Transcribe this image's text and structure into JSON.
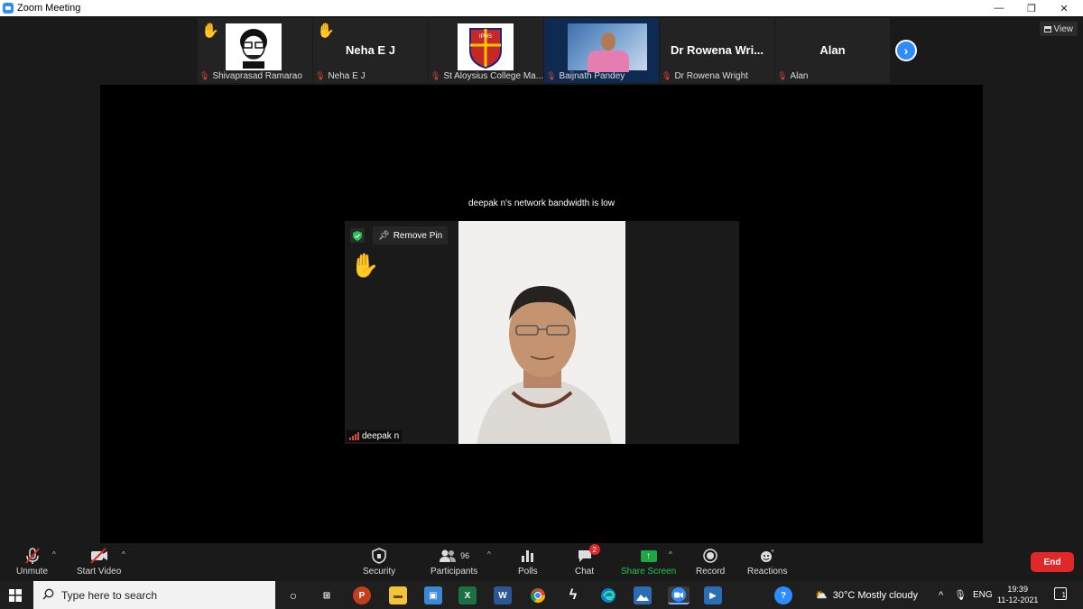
{
  "window": {
    "title": "Zoom Meeting",
    "minimize": "—",
    "restore": "❐",
    "close": "✕"
  },
  "view_button": {
    "label": "View"
  },
  "participants_strip": [
    {
      "name": "Shivaprasad Ramarao",
      "hand_raised": true,
      "muted": true,
      "avatar": "cartoon-avatar"
    },
    {
      "name": "Neha E J",
      "display": "Neha E J",
      "hand_raised": true,
      "muted": true
    },
    {
      "name": "St Aloysius College Ma...",
      "hand_raised": false,
      "muted": true,
      "avatar": "college-crest",
      "crest_text": "IPHS"
    },
    {
      "name": "Baijnath Pandey",
      "hand_raised": false,
      "muted": true,
      "avatar": "video-feed"
    },
    {
      "name": "Dr Rowena Wright",
      "display": "Dr Rowena Wri...",
      "hand_raised": false,
      "muted": true
    },
    {
      "name": "Alan",
      "display": "Alan",
      "hand_raised": false,
      "muted": true
    }
  ],
  "main_view": {
    "notice": "deepak n's network bandwidth is low",
    "pinned_name": "deepak n",
    "remove_pin_label": "Remove Pin"
  },
  "toolbar": {
    "unmute": "Unmute",
    "start_video": "Start Video",
    "security": "Security",
    "participants": "Participants",
    "participants_count": "96",
    "polls": "Polls",
    "chat": "Chat",
    "chat_badge": "2",
    "share_screen": "Share Screen",
    "record": "Record",
    "reactions": "Reactions",
    "end": "End"
  },
  "taskbar": {
    "search_placeholder": "Type here to search",
    "weather": "30°C  Mostly cloudy",
    "language": "ENG",
    "time": "19:39",
    "date": "11-12-2021",
    "notifications": "1"
  },
  "colors": {
    "accent": "#2d8cff",
    "end": "#e02828",
    "share": "#1ea744",
    "muted": "#e0453a"
  }
}
